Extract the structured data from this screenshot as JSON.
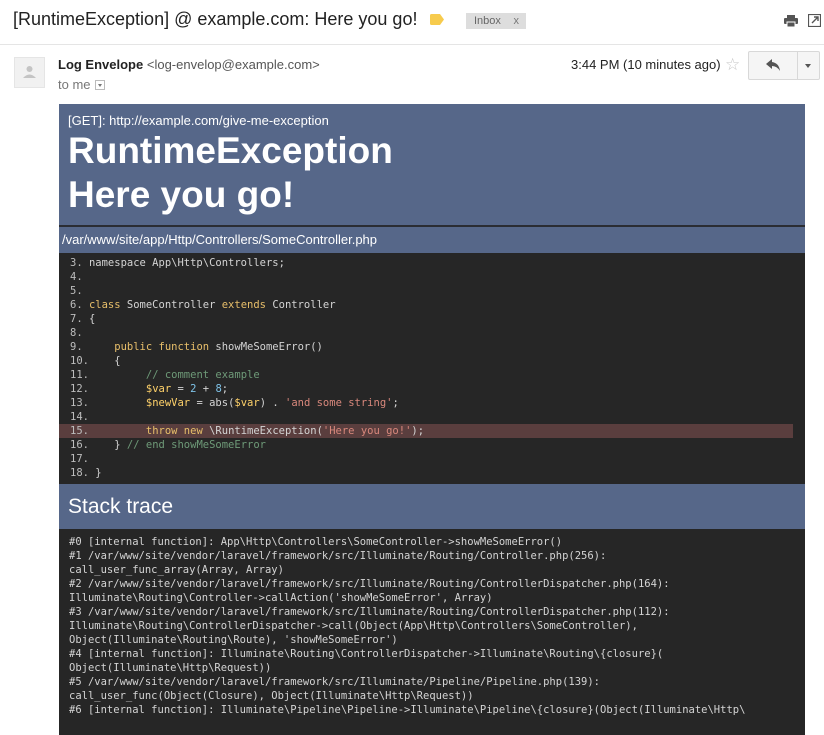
{
  "email": {
    "subject": "[RuntimeException] @ example.com: Here you go!",
    "label_color": "#f7cb4d",
    "inbox_label": "Inbox",
    "inbox_remove": "x",
    "sender_name": "Log Envelope",
    "sender_email": "<log-envelop@example.com>",
    "recipient": "to me",
    "time": "3:44 PM (10 minutes ago)",
    "icons": {
      "print": "print-icon",
      "new_window": "new-window-icon",
      "star": "star-icon",
      "reply": "reply-icon",
      "more": "chevron-down-icon",
      "avatar": "person-icon"
    }
  },
  "report": {
    "request": "[GET]: http://example.com/give-me-exception",
    "exception": "RuntimeException",
    "message": "Here you go!",
    "file": "/var/www/site/app/Http/Controllers/SomeController.php",
    "highlight_line": 15,
    "code_lines": [
      {
        "num": "3.",
        "tokens": [
          {
            "t": "namespace App\\Http\\Controllers;",
            "c": ""
          }
        ]
      },
      {
        "num": "4.",
        "tokens": []
      },
      {
        "num": "5.",
        "tokens": []
      },
      {
        "num": "6.",
        "tokens": [
          {
            "t": "class",
            "c": "kw"
          },
          {
            "t": " SomeController ",
            "c": ""
          },
          {
            "t": "extends",
            "c": "kw"
          },
          {
            "t": " Controller",
            "c": ""
          }
        ]
      },
      {
        "num": "7.",
        "tokens": [
          {
            "t": "{",
            "c": ""
          }
        ]
      },
      {
        "num": "8.",
        "tokens": []
      },
      {
        "num": "9.",
        "tokens": [
          {
            "t": "    ",
            "c": ""
          },
          {
            "t": "public function",
            "c": "kw"
          },
          {
            "t": " showMeSomeError()",
            "c": ""
          }
        ]
      },
      {
        "num": "10.",
        "tokens": [
          {
            "t": "   {",
            "c": ""
          }
        ]
      },
      {
        "num": "11.",
        "tokens": [
          {
            "t": "        ",
            "c": ""
          },
          {
            "t": "// comment example",
            "c": "cm"
          }
        ]
      },
      {
        "num": "12.",
        "tokens": [
          {
            "t": "        ",
            "c": ""
          },
          {
            "t": "$var",
            "c": "var"
          },
          {
            "t": " = ",
            "c": ""
          },
          {
            "t": "2",
            "c": "num"
          },
          {
            "t": " + ",
            "c": ""
          },
          {
            "t": "8",
            "c": "num"
          },
          {
            "t": ";",
            "c": ""
          }
        ]
      },
      {
        "num": "13.",
        "tokens": [
          {
            "t": "        ",
            "c": ""
          },
          {
            "t": "$newVar",
            "c": "var"
          },
          {
            "t": " = abs(",
            "c": ""
          },
          {
            "t": "$var",
            "c": "var"
          },
          {
            "t": ") . ",
            "c": ""
          },
          {
            "t": "'and some string'",
            "c": "str"
          },
          {
            "t": ";",
            "c": ""
          }
        ]
      },
      {
        "num": "14.",
        "tokens": []
      },
      {
        "num": "15.",
        "tokens": [
          {
            "t": "        ",
            "c": ""
          },
          {
            "t": "throw new",
            "c": "kw"
          },
          {
            "t": " \\RuntimeException(",
            "c": ""
          },
          {
            "t": "'Here you go!'",
            "c": "str"
          },
          {
            "t": ");",
            "c": ""
          }
        ]
      },
      {
        "num": "16.",
        "tokens": [
          {
            "t": "   } ",
            "c": ""
          },
          {
            "t": "// end showMeSomeError",
            "c": "cm"
          }
        ]
      },
      {
        "num": "17.",
        "tokens": []
      },
      {
        "num": "18.",
        "tokens": [
          {
            "t": "}",
            "c": ""
          }
        ]
      }
    ],
    "stack_title": "Stack trace",
    "stack_lines": [
      "#0 [internal function]: App\\Http\\Controllers\\SomeController->showMeSomeError()",
      "#1 /var/www/site/vendor/laravel/framework/src/Illuminate/Routing/Controller.php(256):",
      "call_user_func_array(Array, Array)",
      "#2 /var/www/site/vendor/laravel/framework/src/Illuminate/Routing/ControllerDispatcher.php(164):",
      "Illuminate\\Routing\\Controller->callAction('showMeSomeError', Array)",
      "#3 /var/www/site/vendor/laravel/framework/src/Illuminate/Routing/ControllerDispatcher.php(112):",
      "Illuminate\\Routing\\ControllerDispatcher->call(Object(App\\Http\\Controllers\\SomeController),",
      "Object(Illuminate\\Routing\\Route), 'showMeSomeError')",
      "#4 [internal function]: Illuminate\\Routing\\ControllerDispatcher->Illuminate\\Routing\\{closure}(",
      "Object(Illuminate\\Http\\Request))",
      "#5 /var/www/site/vendor/laravel/framework/src/Illuminate/Pipeline/Pipeline.php(139):",
      "call_user_func(Object(Closure), Object(Illuminate\\Http\\Request))",
      "#6 [internal function]: Illuminate\\Pipeline\\Pipeline->Illuminate\\Pipeline\\{closure}(Object(Illuminate\\Http\\"
    ]
  }
}
